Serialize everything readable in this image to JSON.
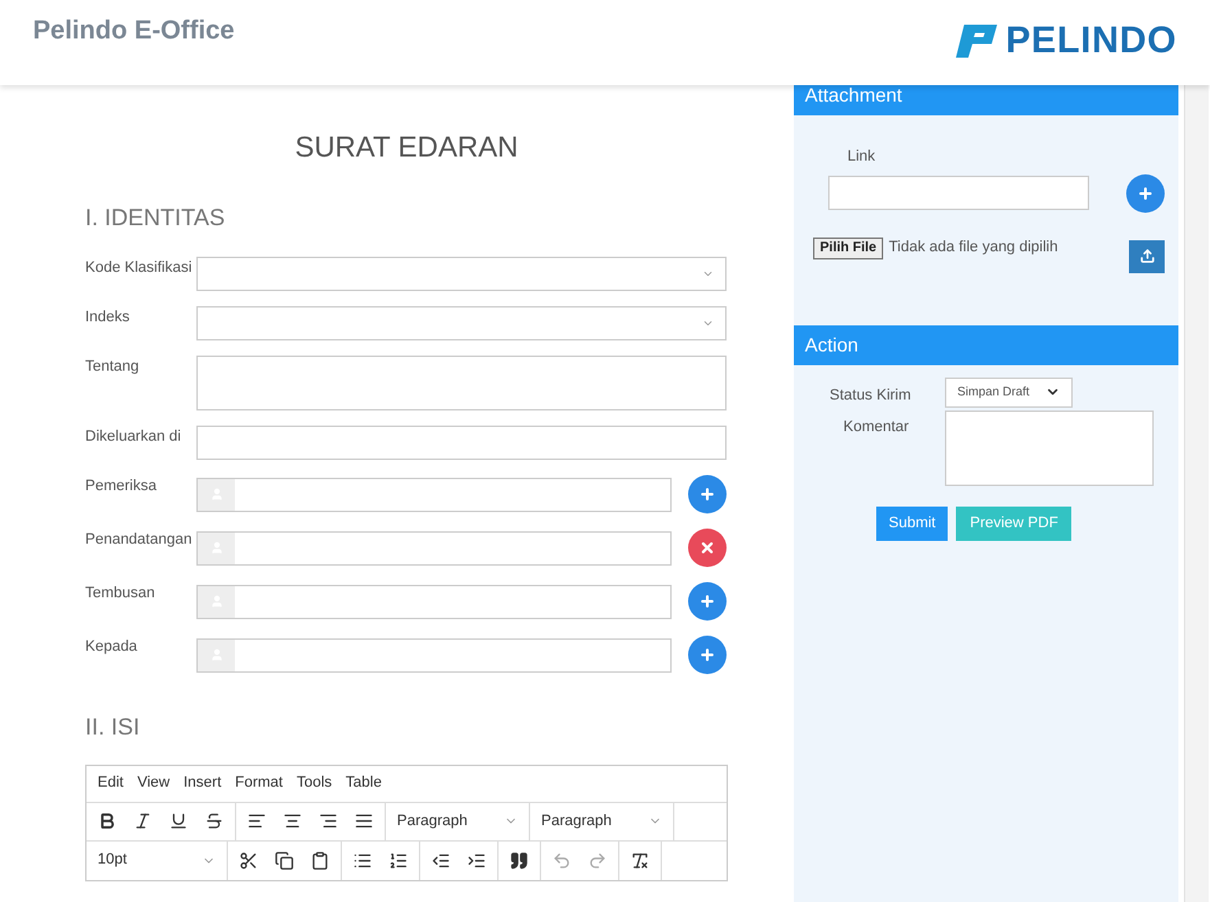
{
  "header": {
    "title": "Pelindo E-Office",
    "logo_text": "PELINDO"
  },
  "document": {
    "title": "SURAT EDARAN",
    "section_1": "I. IDENTITAS",
    "section_2": "II. ISI"
  },
  "fields": [
    {
      "label": "Kode Klasifikasi",
      "kind": "select"
    },
    {
      "label": "Indeks",
      "kind": "select"
    },
    {
      "label": "Tentang",
      "kind": "textarea"
    },
    {
      "label": "Dikeluarkan di",
      "kind": "text"
    },
    {
      "label": "Pemeriksa",
      "kind": "person",
      "removable": false
    },
    {
      "label": "Penandatangan",
      "kind": "person",
      "removable": true
    },
    {
      "label": "Tembusan",
      "kind": "person",
      "removable": false
    },
    {
      "label": "Kepada",
      "kind": "person",
      "removable": false
    }
  ],
  "editor": {
    "menu": [
      "Edit",
      "View",
      "Insert",
      "Format",
      "Tools",
      "Table"
    ],
    "block_formats": [
      "Paragraph",
      "Paragraph"
    ],
    "font_size": "10pt"
  },
  "attachment": {
    "title": "Attachment",
    "link_label": "Link",
    "file_button": "Pilih File",
    "file_status": "Tidak ada file yang dipilih"
  },
  "action": {
    "title": "Action",
    "status_label": "Status Kirim",
    "status_value": "Simpan Draft",
    "comment_label": "Komentar",
    "buttons": [
      {
        "label": "Submit",
        "kind": "primary"
      },
      {
        "label": "Preview PDF",
        "kind": "preview"
      }
    ]
  }
}
